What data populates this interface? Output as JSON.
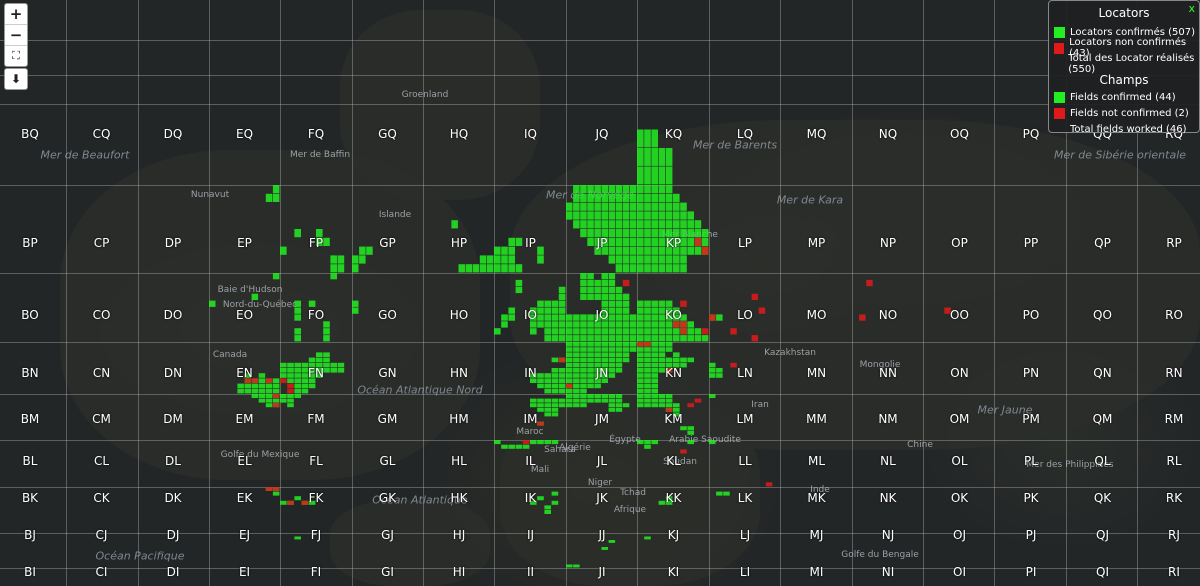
{
  "controls": {
    "zoom_in": "+",
    "zoom_out": "−",
    "fullscreen": "⛶",
    "download": "⬇"
  },
  "legend": {
    "close": "x",
    "title_locators": "Locators",
    "confirmed_label": "Locators confirmés (507)",
    "unconfirmed_label": "Locators non confirmés (43)",
    "total_label": "Total des Locator réalisés (550)",
    "title_fields": "Champs",
    "fields_confirmed": "Fields confirmed (44)",
    "fields_unconfirmed": "Fields not confirmed (2)",
    "fields_total": "Total fields worked (46)"
  },
  "colors": {
    "confirmed": "#22ee22",
    "unconfirmed": "#e01a1a",
    "grid": "#c8c8c8"
  },
  "field_columns": [
    "B",
    "C",
    "D",
    "E",
    "F",
    "G",
    "H",
    "I",
    "J",
    "K",
    "L",
    "M",
    "N",
    "O",
    "P",
    "Q",
    "R"
  ],
  "field_rows": [
    "Q",
    "P",
    "O",
    "N",
    "M",
    "L",
    "K",
    "J",
    "I"
  ],
  "geo_labels": [
    {
      "t": "Mer de Beaufort"
    },
    {
      "t": "Mer de Baffin"
    },
    {
      "t": "Groenland"
    },
    {
      "t": "Mer de Norvège"
    },
    {
      "t": "Mer de Barents"
    },
    {
      "t": "Mer de Sibérie orientale"
    },
    {
      "t": "Baie d'Hudson"
    },
    {
      "t": "Océan Atlantique Nord"
    },
    {
      "t": "Océan Atlantique"
    },
    {
      "t": "Océan Pacifique"
    },
    {
      "t": "Afrique"
    },
    {
      "t": "Mer Blanche"
    },
    {
      "t": "Mer de Kara"
    },
    {
      "t": "Mer Jaune"
    },
    {
      "t": "Golfe du Mexique"
    },
    {
      "t": "Sahara"
    },
    {
      "t": "Mer des Philippines"
    },
    {
      "t": "Golfe du Bengale"
    },
    {
      "t": "Islande"
    },
    {
      "t": "Kazakhstan"
    },
    {
      "t": "Mongolie"
    },
    {
      "t": "Chine"
    },
    {
      "t": "Inde"
    },
    {
      "t": "Arabie Saoudite"
    },
    {
      "t": "Égypte"
    },
    {
      "t": "Algérie"
    },
    {
      "t": "Maroc"
    },
    {
      "t": "Mali"
    },
    {
      "t": "Niger"
    },
    {
      "t": "Tchad"
    },
    {
      "t": "Soudan"
    },
    {
      "t": "Iran"
    },
    {
      "t": "Nunavut"
    },
    {
      "t": "Nord-du-Québec"
    },
    {
      "t": "Canada"
    }
  ],
  "confirmed_squares": [
    "FN03",
    "FN04",
    "FN05",
    "FN12",
    "FN13",
    "FN14",
    "FN15",
    "FN20",
    "FN21",
    "FN22",
    "FN23",
    "FN24",
    "FN25",
    "FN30",
    "FN31",
    "FN32",
    "FN33",
    "FN34",
    "FN35",
    "FN41",
    "FN42",
    "FN43",
    "FN44",
    "FN45",
    "FN46",
    "FN53",
    "FN54",
    "FN55",
    "FN56",
    "FN57",
    "FN64",
    "FN65",
    "FN66",
    "FN67",
    "FN74",
    "FN75",
    "FN84",
    "FN85",
    "EN40",
    "EN41",
    "EN50",
    "EN51",
    "EN52",
    "EN53",
    "EN60",
    "EN61",
    "EN62",
    "EN70",
    "EN71",
    "EN72",
    "EN73",
    "EN80",
    "EN81",
    "EN82",
    "EN90",
    "EN91",
    "EN92",
    "EM69",
    "EM79",
    "EM89",
    "EM99",
    "EM78",
    "EM88",
    "EM98",
    "EM97",
    "EM87",
    "FM08",
    "FM09",
    "FM18",
    "FM19",
    "FM17",
    "FM29",
    "IO51",
    "IO52",
    "IO53",
    "IO54",
    "IO62",
    "IO63",
    "IO64",
    "IO65",
    "IO70",
    "IO71",
    "IO72",
    "IO73",
    "IO74",
    "IO75",
    "IO80",
    "IO81",
    "IO82",
    "IO83",
    "IO84",
    "IO85",
    "IO90",
    "IO91",
    "IO92",
    "IO93",
    "IO94",
    "IO95",
    "IO96",
    "IO97",
    "JO00",
    "JO01",
    "JO02",
    "JO03",
    "JO10",
    "JO11",
    "JO12",
    "JO13",
    "JO20",
    "JO21",
    "JO22",
    "JO23",
    "JO30",
    "JO31",
    "JO32",
    "JO33",
    "JO40",
    "JO41",
    "JO42",
    "JO43",
    "JO50",
    "JO51",
    "JO52",
    "JO53",
    "JO60",
    "JO61",
    "JO62",
    "JO63",
    "JO70",
    "JO71",
    "JO72",
    "JO73",
    "JO80",
    "JO81",
    "JO82",
    "JO83",
    "JO90",
    "JO91",
    "JO92",
    "JO93",
    "JO54",
    "JO64",
    "JO74",
    "JO84",
    "JO55",
    "JO65",
    "JO75",
    "JO85",
    "JO56",
    "JO66",
    "JO76",
    "JO86",
    "JO57",
    "JO67",
    "JO77",
    "JO58",
    "JO68",
    "JO59",
    "JO69",
    "JO29",
    "JO39",
    "JO28",
    "JO38",
    "JO48",
    "JO46",
    "JO47",
    "JO36",
    "JO37",
    "JO26",
    "JO27",
    "JN09",
    "JN19",
    "JN29",
    "JN39",
    "JN49",
    "JN59",
    "JN69",
    "JN79",
    "JN89",
    "JN99",
    "JN08",
    "JN18",
    "JN28",
    "JN38",
    "JN48",
    "JN58",
    "JN68",
    "JN78",
    "JN88",
    "JN98",
    "JN07",
    "JN17",
    "JN27",
    "JN37",
    "JN47",
    "JN57",
    "JN67",
    "JN77",
    "JN87",
    "JN06",
    "JN16",
    "JN26",
    "JN36",
    "JN46",
    "JN56",
    "JN66",
    "JN76",
    "JN86",
    "JN05",
    "JN15",
    "JN25",
    "JN35",
    "JN45",
    "JN55",
    "JN65",
    "JN75",
    "JN04",
    "JN14",
    "JN24",
    "JN34",
    "JN44",
    "JN54",
    "JN64",
    "JN74",
    "JN03",
    "JN13",
    "JN23",
    "JN33",
    "JN43",
    "JN53",
    "JN63",
    "JN02",
    "JN12",
    "JN22",
    "JN32",
    "JN42",
    "JN52",
    "JN01",
    "JN11",
    "JN21",
    "JN31",
    "JN41",
    "JN00",
    "JN10",
    "JN20",
    "IN53",
    "IN63",
    "IN73",
    "IN83",
    "IN93",
    "IN52",
    "IN62",
    "IN72",
    "IN82",
    "IN92",
    "IN61",
    "IN71",
    "IN81",
    "IN91",
    "IN70",
    "IN80",
    "IN90",
    "IN94",
    "IN84",
    "IN86",
    "IN96",
    "IM58",
    "IM68",
    "IM78",
    "IM88",
    "IM98",
    "IM57",
    "IM67",
    "IM77",
    "IM87",
    "IM97",
    "IM66",
    "IM76",
    "IM86",
    "IM75",
    "IM85",
    "IM63",
    "JM08",
    "JM18",
    "JM28",
    "JM38",
    "JM48",
    "JM58",
    "JM68",
    "JM78",
    "JM09",
    "JM19",
    "JM29",
    "JM39",
    "JM49",
    "JM59",
    "JM69",
    "JM79",
    "JM07",
    "JM17",
    "JM27",
    "JM77",
    "JM87",
    "JM76",
    "JM66",
    "JM67",
    "KN00",
    "KN01",
    "KN02",
    "KN03",
    "KN04",
    "KN05",
    "KN06",
    "KN07",
    "KN08",
    "KN09",
    "KN10",
    "KN11",
    "KN12",
    "KN13",
    "KN14",
    "KN15",
    "KN16",
    "KN17",
    "KN18",
    "KN19",
    "KN20",
    "KN21",
    "KN22",
    "KN23",
    "KN24",
    "KN25",
    "KN26",
    "KN27",
    "KN28",
    "KN29",
    "KN34",
    "KN35",
    "KN36",
    "KN37",
    "KN38",
    "KN39",
    "KN44",
    "KN45",
    "KN46",
    "KN48",
    "KN49",
    "KN55",
    "KN56",
    "KN57",
    "KN65",
    "KN66",
    "KN76",
    "KO00",
    "KO01",
    "KO02",
    "KO03",
    "KO04",
    "KO05",
    "KO10",
    "KO11",
    "KO12",
    "KO13",
    "KO14",
    "KO15",
    "KO20",
    "KO21",
    "KO22",
    "KO23",
    "KO24",
    "KO25",
    "KO30",
    "KO31",
    "KO32",
    "KO33",
    "KO34",
    "KO35",
    "KO40",
    "KO41",
    "KO42",
    "KO43",
    "KO44",
    "KO45",
    "KO50",
    "KO51",
    "KO52",
    "KO53",
    "KO54",
    "KO60",
    "KO61",
    "KO62",
    "KO63",
    "KO70",
    "KO71",
    "KO72",
    "KO80",
    "KO81",
    "KO90",
    "KP00",
    "KP01",
    "KP10",
    "KP11",
    "KP20",
    "KP21",
    "KP30",
    "KP31",
    "KP40",
    "KP41",
    "KP50",
    "KP51",
    "KP60",
    "KP61",
    "KM07",
    "KM08",
    "KM09",
    "KM17",
    "KM18",
    "KM19",
    "KM27",
    "KM28",
    "KM29",
    "KM37",
    "KM38",
    "KM39",
    "KM46",
    "KM47",
    "KM48",
    "KM49",
    "KM55",
    "KM56",
    "KM57",
    "KM72",
    "KM71",
    "KM62",
    "KL09",
    "KL19",
    "KL29",
    "KL18",
    "KL79",
    "IL09",
    "IL18",
    "IL28",
    "IL38",
    "IL48",
    "IL59",
    "IL69",
    "IL79",
    "IL89",
    "IK88",
    "IK86",
    "IK67",
    "IK56",
    "IK74",
    "IK75",
    "JJ00",
    "JJ10",
    "JJ55",
    "JJ67",
    "KK36",
    "KK46",
    "KK47",
    "KJ18",
    "LN03",
    "LN04",
    "LN13",
    "LN14",
    "LN05",
    "LM09",
    "LL09",
    "LK18",
    "LK28",
    "LO03",
    "LO13",
    "FK16",
    "FK06",
    "FK27",
    "FK36",
    "FK46",
    "FJ28",
    "EK99",
    "EK98",
    "EK89",
    "EO05",
    "EO66",
    "EO99",
    "FO20",
    "FO21",
    "FO23",
    "FO24",
    "FO25",
    "FO45",
    "FO60",
    "FO61",
    "FO62",
    "FO79",
    "FP02",
    "FP24",
    "FP53",
    "FP54",
    "FP63",
    "FP70",
    "FP71",
    "FP80",
    "FP81",
    "EP99",
    "EP98",
    "EP88",
    "GP00",
    "GP11",
    "GP22",
    "GP01",
    "GP12",
    "GO05",
    "GO04",
    "HP45",
    "HP50",
    "HP60",
    "HP70",
    "HP80",
    "HP81",
    "HP90",
    "HP91",
    "IP00",
    "IP01",
    "IP02",
    "IP10",
    "IP11",
    "IP12",
    "IP20",
    "IP21",
    "IP22",
    "IP23",
    "IP30",
    "IP33",
    "IP61",
    "IP62",
    "JP06",
    "JP07",
    "JP15",
    "JP16",
    "JP17",
    "JP18",
    "JP19",
    "JP24",
    "JP25",
    "JP26",
    "JP27",
    "JP28",
    "JP29",
    "JP33",
    "JP34",
    "JP35",
    "JP36",
    "JP37",
    "JP38",
    "JP39",
    "JP42",
    "JP43",
    "JP44",
    "JP45",
    "JP46",
    "JP47",
    "JP48",
    "JP49",
    "JP52",
    "JP53",
    "JP54",
    "JP55",
    "JP56",
    "JP57",
    "JP58",
    "JP59",
    "JP61",
    "JP62",
    "JP63",
    "JP64",
    "JP65",
    "JP66",
    "JP67",
    "JP68",
    "JP69",
    "JP70",
    "JP71",
    "JP72",
    "JP73",
    "JP74",
    "JP75",
    "JP76",
    "JP77",
    "JP78",
    "JP79",
    "JP80",
    "JP81",
    "JP82",
    "JP83",
    "JP84",
    "JP85",
    "JP86",
    "JP87",
    "JP88",
    "JP89",
    "JP90",
    "JP91",
    "JP92",
    "JP93",
    "JP94",
    "JP95",
    "JP96",
    "JP97",
    "JP98",
    "JP99",
    "KP02",
    "KP03",
    "KP04",
    "KP05",
    "KP06",
    "KP07",
    "KP08",
    "KP09",
    "KP12",
    "KP13",
    "KP14",
    "KP15",
    "KP16",
    "KP17",
    "KP18",
    "KP19",
    "KP22",
    "KP23",
    "KP24",
    "KP25",
    "KP26",
    "KP27",
    "KP28",
    "KP29",
    "KP32",
    "KP33",
    "KP34",
    "KP35",
    "KP36",
    "KP37",
    "KP38",
    "KP39",
    "KP42",
    "KP43",
    "KP44",
    "KP45",
    "KP46",
    "KP47",
    "KP48",
    "KP49",
    "KP52",
    "KP53",
    "KP54",
    "KP55",
    "KP56",
    "KP57",
    "KP58",
    "KP62",
    "KP63",
    "KP64",
    "KP65",
    "KP66",
    "KP67",
    "KP72",
    "KP73",
    "KP74",
    "KP75",
    "KP76",
    "KP82",
    "KP83",
    "KP84",
    "KP85",
    "KP92",
    "KP93",
    "KP94",
    "KQ00",
    "KQ01",
    "KQ02",
    "KQ10",
    "KQ11",
    "KQ12",
    "KQ20",
    "KQ21",
    "KQ22",
    "KQ30",
    "KQ31",
    "KQ40",
    "KQ41",
    "IO01",
    "IO13",
    "IO12",
    "IO23",
    "IO24",
    "IO37",
    "IO38"
  ],
  "unconfirmed_squares": [
    "FN02",
    "FN10",
    "FN11",
    "EN82",
    "EN52",
    "EN62",
    "EM99",
    "EM97",
    "JN01",
    "JO88",
    "KN09",
    "KN19",
    "KN44",
    "KO52",
    "KO61",
    "KO62",
    "KO91",
    "KO65",
    "LO31",
    "LO60",
    "LO74",
    "LO66",
    "NO13",
    "NO28",
    "OO34",
    "KM46",
    "KM77",
    "KM88",
    "IM63",
    "IL49",
    "IN96",
    "KP92",
    "KP83",
    "LO03",
    "FK36",
    "FK16",
    "EK99",
    "EK89",
    "LN35",
    "LL80",
    "KL67"
  ]
}
